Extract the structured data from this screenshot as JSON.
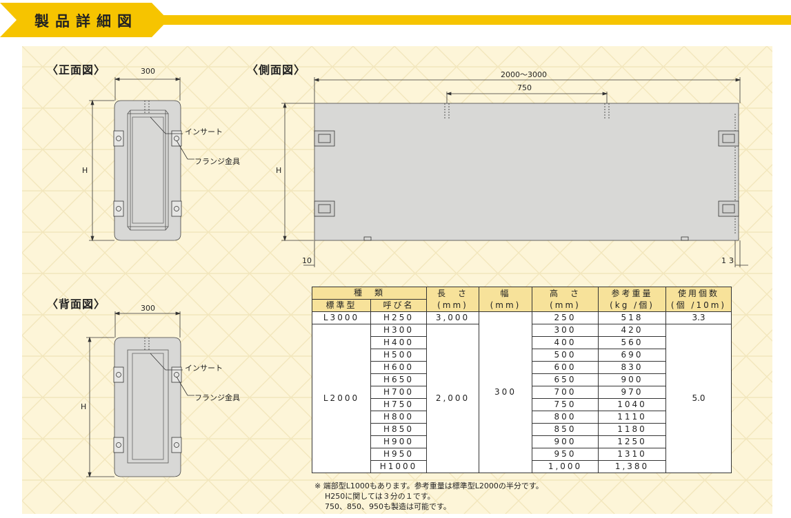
{
  "header": {
    "title": "製品詳細図"
  },
  "views": {
    "front": {
      "title": "〈正面図〉",
      "width": "300",
      "height": "H",
      "insert": "インサート",
      "flange": "フランジ金具"
    },
    "side": {
      "title": "〈側面図〉",
      "length": "2000～3000",
      "inner": "750",
      "height": "H",
      "left_offset": "10",
      "right_offset": "13"
    },
    "back": {
      "title": "〈背面図〉",
      "width": "300",
      "height": "H",
      "insert": "インサート",
      "flange": "フランジ金具"
    }
  },
  "table": {
    "headers": {
      "kind": "種　類",
      "standard": "標準型",
      "name": "呼び名",
      "length": "長　さ",
      "width": "幅",
      "height": "高　さ",
      "weight": "参考重量",
      "count": "使用個数",
      "mm": "(mm)",
      "kg": "(kg /個)",
      "per10": "(個 /10m)"
    },
    "row1": {
      "standard": "L3000",
      "name": "H250",
      "length": "3,000",
      "height": "250",
      "weight": "518",
      "count": "3.3"
    },
    "group": {
      "standard": "L2000",
      "length": "2,000",
      "width": "300",
      "count": "5.0"
    },
    "rows": [
      {
        "name": "H300",
        "height": "300",
        "weight": "420"
      },
      {
        "name": "H400",
        "height": "400",
        "weight": "560"
      },
      {
        "name": "H500",
        "height": "500",
        "weight": "690"
      },
      {
        "name": "H600",
        "height": "600",
        "weight": "830"
      },
      {
        "name": "H650",
        "height": "650",
        "weight": "900"
      },
      {
        "name": "H700",
        "height": "700",
        "weight": "970"
      },
      {
        "name": "H750",
        "height": "750",
        "weight": "1040"
      },
      {
        "name": "H800",
        "height": "800",
        "weight": "1110"
      },
      {
        "name": "H850",
        "height": "850",
        "weight": "1180"
      },
      {
        "name": "H900",
        "height": "900",
        "weight": "1250"
      },
      {
        "name": "H950",
        "height": "950",
        "weight": "1310"
      },
      {
        "name": "H1000",
        "height": "1,000",
        "weight": "1,380"
      }
    ]
  },
  "notes": [
    "※ 端部型L1000もあります。参考重量は標準型L2000の半分です。",
    "H250に関しては３分の１です。",
    "750、850、950も製造は可能です。"
  ],
  "colors": {
    "banner": "#f6c400",
    "panel": "#fdf5d8",
    "block": "#d8d8d6",
    "table_header": "#f7e29a"
  }
}
